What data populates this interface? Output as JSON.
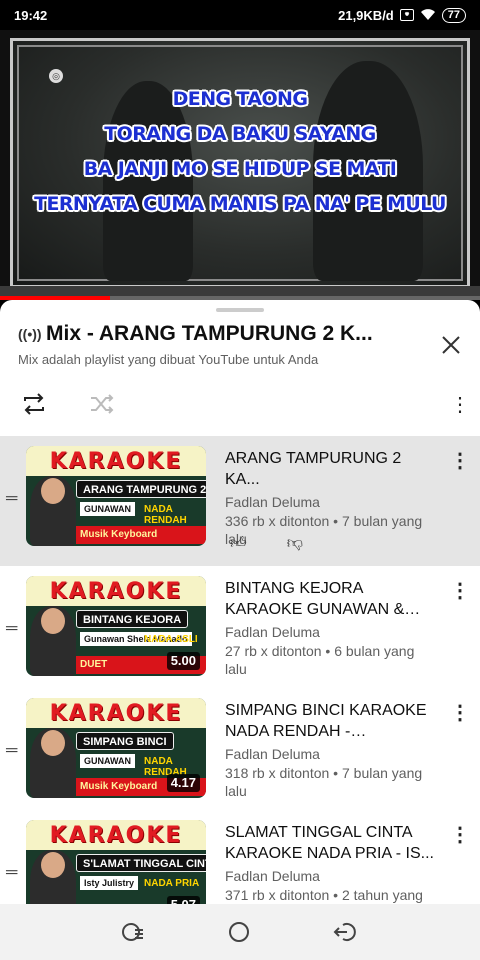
{
  "status": {
    "time": "19:42",
    "network_speed": "21,9KB/d",
    "battery": "77"
  },
  "video": {
    "lyrics": [
      "DENG TAONG",
      "TORANG DA BAKU SAYANG",
      "BA JANJI MO SE HIDUP SE MATI",
      "TERNYATA CUMA MANIS PA NA' PE MULU"
    ],
    "progress_percent": 23
  },
  "playlist": {
    "title": "Mix - ARANG TAMPURUNG 2 K...",
    "subtitle": "Mix adalah playlist yang dibuat YouTube untuk Anda",
    "icons": {
      "radio": "radio-icon",
      "close": "close-icon",
      "repeat": "repeat-icon",
      "shuffle": "shuffle-icon",
      "more": "more-vert-icon"
    }
  },
  "items": [
    {
      "title": "ARANG TAMPURUNG 2 KA...",
      "channel": "Fadlan Deluma",
      "meta": "336 rb x ditonton • 7 bulan yang lalu",
      "thumb_banner": "KARAOKE",
      "thumb_song": "ARANG TAMPURUNG 2",
      "thumb_sub": "GUNAWAN",
      "thumb_yellow": "NADA RENDAH",
      "thumb_bottom": "Musik Keyboard",
      "duration": ""
    },
    {
      "title": "BINTANG KEJORA KARAOKE GUNAWAN & SH...",
      "channel": "Fadlan Deluma",
      "meta": "27 rb x ditonton • 6 bulan yang lalu",
      "thumb_banner": "KARAOKE",
      "thumb_song": "BINTANG KEJORA",
      "thumb_sub": "Gunawan Shela Manado",
      "thumb_yellow": "NADA ASLI",
      "thumb_bottom": "DUET",
      "duration": "5.00"
    },
    {
      "title": "SIMPANG BINCI KARAOKE NADA RENDAH - GUNAWA...",
      "channel": "Fadlan Deluma",
      "meta": "318 rb x ditonton • 7 bulan yang lalu",
      "thumb_banner": "KARAOKE",
      "thumb_song": "SIMPANG BINCI",
      "thumb_sub": "GUNAWAN",
      "thumb_yellow": "NADA RENDAH",
      "thumb_bottom": "Musik Keyboard",
      "duration": "4.17"
    },
    {
      "title": "SLAMAT TINGGAL CINTA KARAOKE NADA PRIA - IS...",
      "channel": "Fadlan Deluma",
      "meta": "371 rb x ditonton • 2 tahun yang lalu",
      "thumb_banner": "KARAOKE",
      "thumb_song": "S'LAMAT TINGGAL CINTA",
      "thumb_sub": "Isty Julistry",
      "thumb_yellow": "NADA PRIA",
      "thumb_bottom": "",
      "duration": "5.07"
    }
  ]
}
